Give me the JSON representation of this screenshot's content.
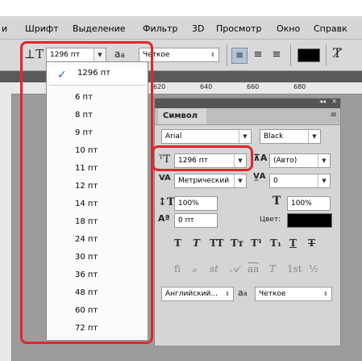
{
  "menu": [
    "и",
    "Шрифт",
    "Выделение",
    "Фильтр",
    "3D",
    "Просмотр",
    "Окно",
    "Справк"
  ],
  "options_bar": {
    "text_tool_icon": "T-orientation-icon",
    "font_size": "1296 пт",
    "aa_label": "a",
    "aa_sub": "a",
    "antialias": "Четкое"
  },
  "ruler": {
    "labels": [
      "620",
      "640",
      "660",
      "680"
    ]
  },
  "size_dropdown": {
    "selected": "1296 пт",
    "items": [
      "6 пт",
      "8 пт",
      "9 пт",
      "10 пт",
      "11 пт",
      "12 пт",
      "14 пт",
      "18 пт",
      "24 пт",
      "30 пт",
      "36 пт",
      "48 пт",
      "60 пт",
      "72 пт"
    ]
  },
  "panel": {
    "collapse": "◂◂",
    "close": "✕",
    "tab": "Символ",
    "font_family": "Arial",
    "font_style": "Black",
    "font_size": "1296 пт",
    "leading": "(Авто)",
    "kerning": "Метрический",
    "tracking": "0",
    "vscale": "100%",
    "hscale": "100%",
    "baseline": "0 пт",
    "color_label": "Цвет:",
    "color_value": "#000000",
    "typo_buttons": [
      "T",
      "T",
      "TT",
      "Tт",
      "T¹",
      "T₁",
      "T",
      "T"
    ],
    "opentype_buttons": [
      "ﬁ",
      "ℴ",
      "st",
      "𝒜",
      "aa",
      "T",
      "1st",
      "½"
    ],
    "language": "Английский...",
    "aa_label": "a",
    "antialias": "Четкое"
  }
}
